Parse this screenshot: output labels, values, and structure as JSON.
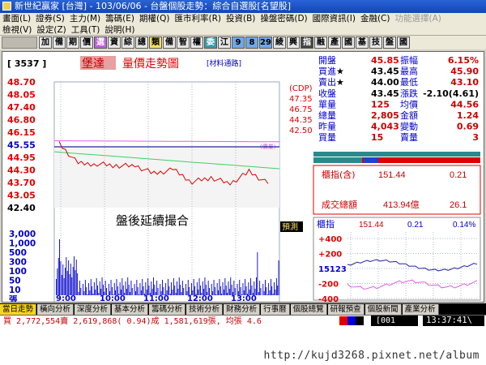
{
  "window": {
    "title": "新世紀贏家 [台灣] - 103/06/06 - 台盤個股走勢：綜合自選股[名望股]"
  },
  "menu": {
    "row1": [
      "畫面(L)",
      "證券(S)",
      "主力(M)",
      "籌碼(E)",
      "期權(Q)",
      "匯市利率(R)",
      "投資(B)",
      "操盤密碼(D)",
      "國際資訊(I)",
      "金融(C)",
      "功能選擇(A)"
    ],
    "row1_disabled": [
      "功能選擇(A)"
    ],
    "row2": [
      "檢視(V)",
      "設定(Z)",
      "工具(T)",
      "說明(H)"
    ]
  },
  "toolbar": {
    "buttons": [
      "加",
      "備",
      "期",
      "價",
      "選",
      "資",
      "綜",
      "總",
      "類",
      "備",
      "智",
      "權",
      "委",
      "江",
      "9",
      "8",
      "29",
      "綾",
      "興",
      "指",
      "融",
      "產",
      "國",
      "基",
      "技",
      "盤",
      "國"
    ]
  },
  "stock": {
    "code": "[ 3537 ]",
    "name": "堡達",
    "chart_title": "量價走勢圖",
    "link": "[材料通路]",
    "closed_notice": "盤後延續撮合",
    "predict": "預測"
  },
  "axes": {
    "price_ticks": [
      "48.70",
      "48.05",
      "47.40",
      "46.80",
      "46.15",
      "45.55",
      "44.95",
      "44.30",
      "43.70",
      "43.05",
      "42.40"
    ],
    "vol_ticks": [
      "3,000",
      "1,000",
      "500",
      "300",
      "100",
      "50",
      "10",
      "張"
    ],
    "time_ticks": [
      "9:00",
      "10:00",
      "11:00",
      "12:00",
      "13:00"
    ],
    "cdp": [
      {
        "label": "(CDP)",
        "value": ""
      },
      {
        "label": "",
        "value": "47.35"
      },
      {
        "label": "",
        "value": "46.75"
      },
      {
        "label": "",
        "value": "44.35"
      },
      {
        "label": "",
        "value": "42.50"
      }
    ],
    "vol_tag": "(價量)"
  },
  "quote": {
    "rows": [
      {
        "l": "開盤",
        "lv": "45.85",
        "r": "振幅",
        "rv": "6.15%"
      },
      {
        "l": "買進",
        "lv": "43.45",
        "r": "最高",
        "rv": "45.90"
      },
      {
        "l": "賣出",
        "lv": "44.00",
        "r": "最低",
        "rv": "43.10"
      },
      {
        "l": "收盤",
        "lv": "43.45",
        "r": "漲跌",
        "rv": "-2.10(4.61)"
      },
      {
        "l": "單量",
        "lv": "125",
        "r": "均價",
        "rv": "44.56"
      },
      {
        "l": "總量",
        "lv": "2,805",
        "r": "金額",
        "rv": "1.24"
      },
      {
        "l": "昨量",
        "lv": "4,043",
        "r": "變動",
        "rv": "0.69"
      },
      {
        "l": "買量",
        "lv": "15",
        "r": "賣量",
        "rv": "3"
      }
    ],
    "star": "★"
  },
  "index_box": {
    "label": "櫃指(含)",
    "value": "151.44",
    "change": "0.21",
    "turnover_label": "成交總額",
    "turnover": "413.94億",
    "turnover_change": "26.1"
  },
  "mini": {
    "label": "櫃指",
    "value": "151.44",
    "change": "0.21",
    "pct": "0.14%",
    "ticks": [
      "+400",
      "+200",
      "15123",
      "-200",
      "-400"
    ]
  },
  "tabs": [
    "當日走勢",
    "橫向分析",
    "深度分析",
    "基本分析",
    "籌碼分析",
    "技術分析",
    "財務分析",
    "行事曆",
    "個股總覽",
    "研報預查",
    "個股新聞",
    "產業分析"
  ],
  "status": {
    "text": "買 2,772,554賣 2,619,868( 0.94)成 1,581,619張, 均張 4.6",
    "code": "[001",
    "clock": "13:37:41\\"
  },
  "watermark": "http://kujd3268.pixnet.net/album",
  "chart_data": {
    "type": "line",
    "x": [
      "9:00",
      "10:00",
      "11:00",
      "12:00",
      "13:00"
    ],
    "series": [
      {
        "values": [
          45.6,
          44.6,
          44.6,
          44.5,
          44.5,
          44.1,
          44.3,
          43.7,
          43.9,
          43.6,
          44.2,
          43.6
        ]
      }
    ],
    "ylim": [
      42.4,
      48.7
    ]
  },
  "colors": {
    "accent_red": "#e00000",
    "accent_blue": "#0000cc",
    "tab_active": "#f7d51d"
  }
}
